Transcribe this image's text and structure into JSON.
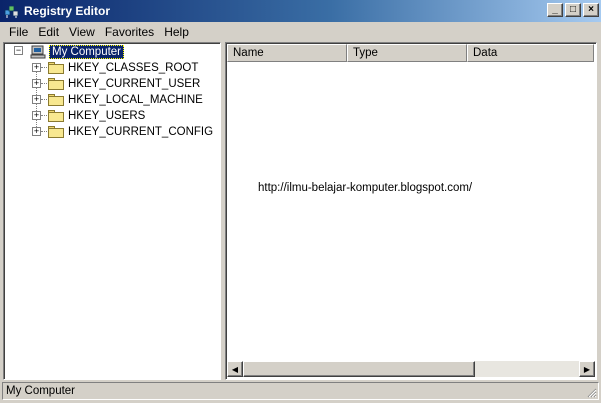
{
  "window": {
    "title": "Registry Editor",
    "icon": "registry-editor-icon",
    "caption_buttons": {
      "minimize": "_",
      "maximize": "□",
      "close": "×"
    }
  },
  "menu": [
    "File",
    "Edit",
    "View",
    "Favorites",
    "Help"
  ],
  "tree": {
    "root": {
      "label": "My Computer",
      "icon": "computer-icon",
      "expanded": true,
      "selected": true
    },
    "children": [
      {
        "label": "HKEY_CLASSES_ROOT",
        "icon": "folder-icon"
      },
      {
        "label": "HKEY_CURRENT_USER",
        "icon": "folder-icon"
      },
      {
        "label": "HKEY_LOCAL_MACHINE",
        "icon": "folder-icon"
      },
      {
        "label": "HKEY_USERS",
        "icon": "folder-icon"
      },
      {
        "label": "HKEY_CURRENT_CONFIG",
        "icon": "folder-icon"
      }
    ]
  },
  "list": {
    "columns": [
      "Name",
      "Type",
      "Data"
    ],
    "overlay_text": "http://ilmu-belajar-komputer.blogspot.com/"
  },
  "statusbar": {
    "text": "My Computer"
  },
  "colors": {
    "selection": "#0a246a",
    "titlebar_start": "#0a246a",
    "titlebar_end": "#a6caf0",
    "face": "#d4d0c8"
  }
}
